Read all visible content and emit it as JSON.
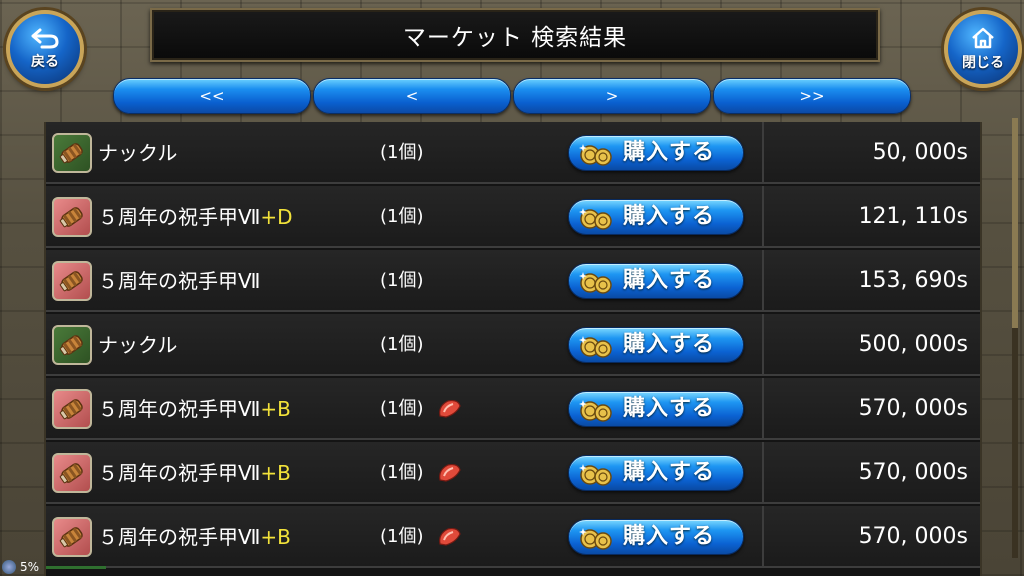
{
  "header": {
    "title": "マーケット 検索結果",
    "back_label": "戻る",
    "close_label": "閉じる"
  },
  "pager": {
    "first": "<<",
    "prev": "<",
    "next": ">",
    "last": ">>"
  },
  "buy_label": "購入する",
  "items": [
    {
      "name": "ナックル",
      "suffix": "",
      "qty": "(1個)",
      "price": "50, 000s",
      "icon": "knuckle-icon",
      "icon_bg": "green",
      "enhance_icon": false
    },
    {
      "name": "５周年の祝手甲Ⅶ",
      "suffix": "+D",
      "qty": "(1個)",
      "price": "121, 110s",
      "icon": "gauntlet-icon",
      "icon_bg": "pink",
      "enhance_icon": false
    },
    {
      "name": "５周年の祝手甲Ⅶ",
      "suffix": "",
      "qty": "(1個)",
      "price": "153, 690s",
      "icon": "gauntlet-icon",
      "icon_bg": "pink",
      "enhance_icon": false
    },
    {
      "name": "ナックル",
      "suffix": "",
      "qty": "(1個)",
      "price": "500, 000s",
      "icon": "knuckle-icon",
      "icon_bg": "green",
      "enhance_icon": false
    },
    {
      "name": "５周年の祝手甲Ⅶ",
      "suffix": "+B",
      "qty": "(1個)",
      "price": "570, 000s",
      "icon": "gauntlet-icon",
      "icon_bg": "pink",
      "enhance_icon": true
    },
    {
      "name": "５周年の祝手甲Ⅶ",
      "suffix": "+B",
      "qty": "(1個)",
      "price": "570, 000s",
      "icon": "gauntlet-icon",
      "icon_bg": "pink",
      "enhance_icon": true
    },
    {
      "name": "５周年の祝手甲Ⅶ",
      "suffix": "+B",
      "qty": "(1個)",
      "price": "570, 000s",
      "icon": "gauntlet-icon",
      "icon_bg": "pink",
      "enhance_icon": true
    }
  ],
  "status": {
    "battery": "5%"
  },
  "colors": {
    "button_blue": "#1b8ef0",
    "suffix_yellow": "#f2e23a",
    "frame_gold": "#c9a559"
  }
}
